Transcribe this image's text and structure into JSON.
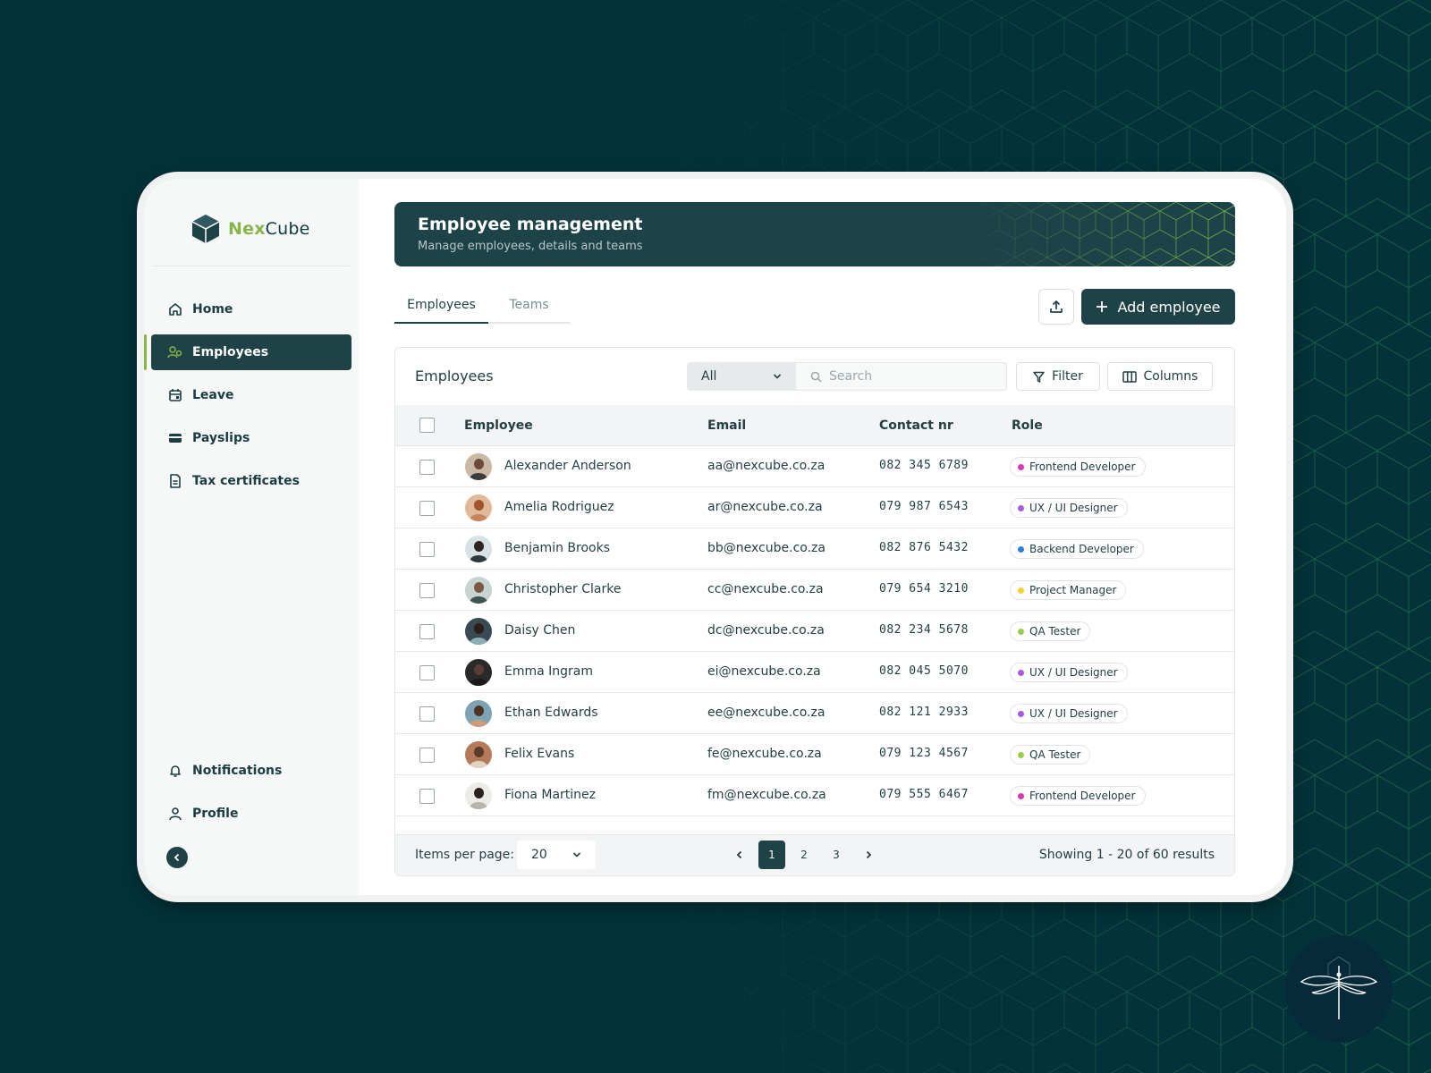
{
  "brand": {
    "name_prefix": "Nex",
    "name_suffix": "Cube",
    "accent": "#8ab34a",
    "primary": "#1f4247"
  },
  "sidebar": {
    "items": [
      {
        "label": "Home",
        "icon": "home-icon"
      },
      {
        "label": "Employees",
        "icon": "users-icon",
        "active": true
      },
      {
        "label": "Leave",
        "icon": "calendar-icon"
      },
      {
        "label": "Payslips",
        "icon": "wallet-icon"
      },
      {
        "label": "Tax certificates",
        "icon": "document-icon"
      }
    ],
    "bottom_items": [
      {
        "label": "Notifications",
        "icon": "bell-icon"
      },
      {
        "label": "Profile",
        "icon": "user-icon"
      }
    ],
    "collapse_icon": "chevron-left-icon"
  },
  "header": {
    "title": "Employee management",
    "subtitle": "Manage employees, details and teams"
  },
  "tabs": [
    {
      "label": "Employees",
      "active": true
    },
    {
      "label": "Teams",
      "active": false
    }
  ],
  "actions": {
    "upload_icon": "upload-icon",
    "add_label": "Add employee"
  },
  "table_card": {
    "title": "Employees",
    "filter_select": "All",
    "search_placeholder": "Search",
    "filter_label": "Filter",
    "columns_label": "Columns",
    "headers": [
      "Employee",
      "Email",
      "Contact nr",
      "Role"
    ],
    "rows": [
      {
        "name": "Alexander Anderson",
        "email": "aa@nexcube.co.za",
        "phone": "082 345 6789",
        "role": "Frontend Developer",
        "role_color": "#d63ab5"
      },
      {
        "name": "Amelia Rodriguez",
        "email": "ar@nexcube.co.za",
        "phone": "079 987 6543",
        "role": "UX / UI Designer",
        "role_color": "#a35be0"
      },
      {
        "name": "Benjamin Brooks",
        "email": "bb@nexcube.co.za",
        "phone": "082 876 5432",
        "role": "Backend Developer",
        "role_color": "#2f7fe0"
      },
      {
        "name": "Christopher Clarke",
        "email": "cc@nexcube.co.za",
        "phone": "079 654 3210",
        "role": "Project Manager",
        "role_color": "#f0d23a"
      },
      {
        "name": "Daisy Chen",
        "email": "dc@nexcube.co.za",
        "phone": "082 234 5678",
        "role": "QA Tester",
        "role_color": "#9ccc4a"
      },
      {
        "name": "Emma Ingram",
        "email": "ei@nexcube.co.za",
        "phone": "082 045 5070",
        "role": "UX / UI Designer",
        "role_color": "#a35be0"
      },
      {
        "name": "Ethan Edwards",
        "email": "ee@nexcube.co.za",
        "phone": "082 121 2933",
        "role": "UX / UI Designer",
        "role_color": "#a35be0"
      },
      {
        "name": "Felix Evans",
        "email": "fe@nexcube.co.za",
        "phone": "079 123 4567",
        "role": "QA Tester",
        "role_color": "#9ccc4a"
      },
      {
        "name": "Fiona Martinez",
        "email": "fm@nexcube.co.za",
        "phone": "079 555 6467",
        "role": "Frontend Developer",
        "role_color": "#d63ab5"
      }
    ],
    "footer": {
      "items_per_page_label": "Items per page:",
      "items_per_page_value": "20",
      "pages": [
        "1",
        "2",
        "3"
      ],
      "current_page": "1",
      "results_text": "Showing 1 - 20 of 60 results"
    }
  }
}
